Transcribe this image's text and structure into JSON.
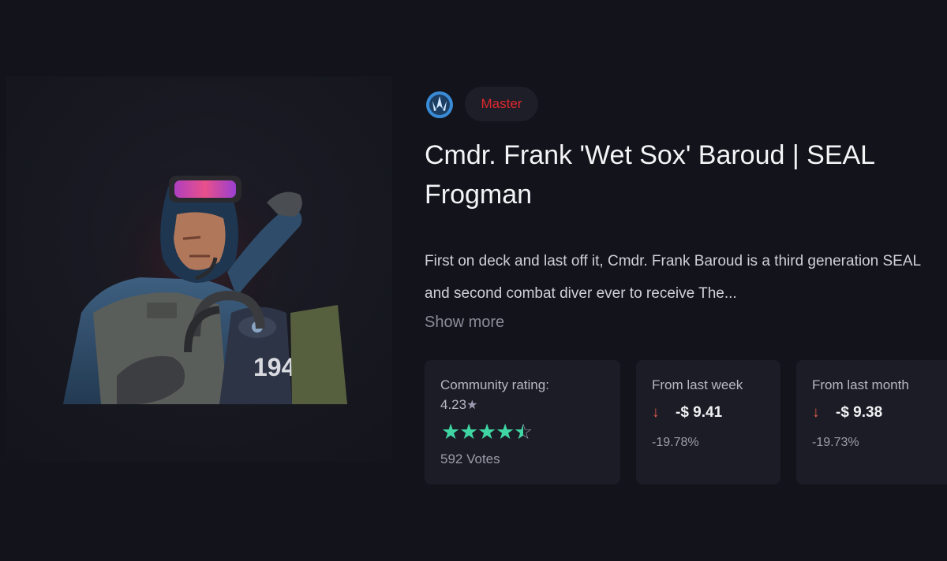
{
  "header": {
    "rank_icon": "winged-emblem-icon",
    "rarity": "Master",
    "rarity_color": "#e0282e",
    "title": "Cmdr. Frank 'Wet Sox' Baroud | SEAL Frogman"
  },
  "description": {
    "text": "First on deck and last off it, Cmdr. Frank Baroud is a third generation SEAL and second combat diver ever to receive The...",
    "show_more": "Show more"
  },
  "agent_image": {
    "icon": "frogman-agent-portrait",
    "rebreather_number": "194"
  },
  "stats": {
    "rating": {
      "label": "Community rating:",
      "value": "4.23",
      "stars": 4.23,
      "votes": "592 Votes",
      "star_color": "#3fd6a4"
    },
    "week": {
      "label": "From last week",
      "change": "-$ 9.41",
      "percent": "-19.78%",
      "trend": "down"
    },
    "month": {
      "label": "From last month",
      "change": "-$ 9.38",
      "percent": "-19.73%",
      "trend": "down"
    }
  },
  "colors": {
    "background": "#12131b",
    "card": "#1b1c25",
    "down_arrow": "#e05a4e"
  }
}
